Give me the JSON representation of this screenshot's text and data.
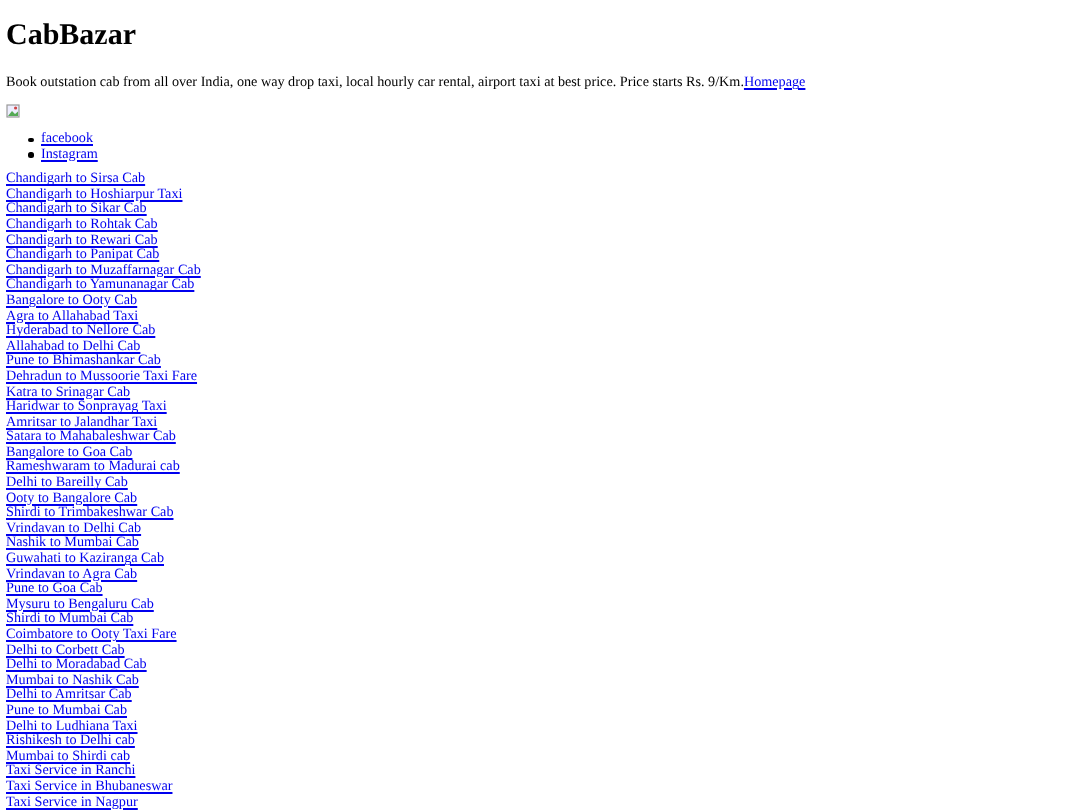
{
  "title": "CabBazar",
  "description": "Book outstation cab from all over India, one way drop taxi, local hourly car rental, airport taxi at best price. Price starts Rs. 9/Km.",
  "homepage_link": "Homepage",
  "banner": {
    "kind": "broken-image"
  },
  "social_links": [
    "facebook",
    "Instagram"
  ],
  "route_links": [
    "Chandigarh to Sirsa Cab",
    "Chandigarh to Hoshiarpur Taxi",
    "Chandigarh to Sikar Cab",
    "Chandigarh to Rohtak Cab",
    "Chandigarh to Rewari Cab",
    "Chandigarh to Panipat Cab",
    "Chandigarh to Muzaffarnagar Cab",
    "Chandigarh to Yamunanagar Cab",
    "Bangalore to Ooty Cab",
    "Agra to Allahabad Taxi",
    "Hyderabad to Nellore Cab",
    "Allahabad to Delhi Cab",
    "Pune to Bhimashankar Cab",
    "Dehradun to Mussoorie Taxi Fare",
    "Katra to Srinagar Cab",
    "Haridwar to Sonprayag Taxi",
    "Amritsar to Jalandhar Taxi",
    "Satara to Mahabaleshwar Cab",
    "Bangalore to Goa Cab",
    "Rameshwaram to Madurai cab",
    "Delhi to Bareilly Cab",
    "Ooty to Bangalore Cab",
    "Shirdi to Trimbakeshwar Cab",
    "Vrindavan to Delhi Cab",
    "Nashik to Mumbai Cab",
    "Guwahati to Kaziranga Cab",
    "Vrindavan to Agra Cab",
    "Pune to Goa Cab",
    "Mysuru to Bengaluru Cab",
    "Shirdi to Mumbai Cab",
    "Coimbatore to Ooty Taxi Fare",
    "Delhi to Corbett Cab",
    "Delhi to Moradabad Cab",
    "Mumbai to Nashik Cab",
    "Delhi to Amritsar Cab",
    "Pune to Mumbai Cab",
    "Delhi to Ludhiana Taxi",
    "Rishikesh to Delhi cab",
    "Mumbai to Shirdi cab",
    "Taxi Service in Ranchi",
    "Taxi Service in Bhubaneswar",
    "Taxi Service in Nagpur"
  ]
}
